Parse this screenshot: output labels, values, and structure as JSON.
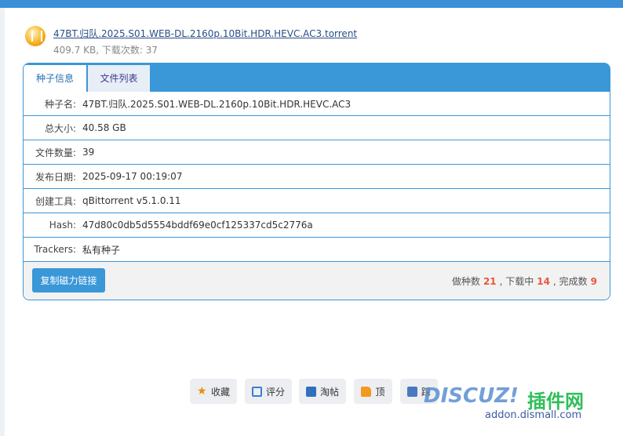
{
  "torrent": {
    "filename": "47BT.归队.2025.S01.WEB-DL.2160p.10Bit.HDR.HEVC.AC3.torrent",
    "meta": "409.7 KB, 下载次数: 37"
  },
  "tabs": [
    {
      "label": "种子信息",
      "active": true
    },
    {
      "label": "文件列表",
      "active": false
    }
  ],
  "rows": [
    {
      "label": "种子名:",
      "value": "47BT.归队.2025.S01.WEB-DL.2160p.10Bit.HDR.HEVC.AC3"
    },
    {
      "label": "总大小:",
      "value": "40.58 GB"
    },
    {
      "label": "文件数量:",
      "value": "39"
    },
    {
      "label": "发布日期:",
      "value": "2025-09-17 00:19:07"
    },
    {
      "label": "创建工具:",
      "value": "qBittorrent v5.1.0.11"
    },
    {
      "label": "Hash:",
      "value": "47d80c0db5d5554bddf69e0cf125337cd5c2776a"
    },
    {
      "label": "Trackers:",
      "value": "私有种子"
    }
  ],
  "footer": {
    "copy_magnet": "复制磁力链接",
    "seeders_label": "做种数",
    "seeders": "21",
    "leechers_label": ", 下载中",
    "leechers": "14",
    "completed_label": ", 完成数",
    "completed": "9"
  },
  "actions": [
    {
      "label": "收藏",
      "icon": "star-icon"
    },
    {
      "label": "评分",
      "icon": "calendar-icon"
    },
    {
      "label": "淘帖",
      "icon": "box-icon"
    },
    {
      "label": "顶",
      "icon": "thumbs-up-icon"
    },
    {
      "label": "踩",
      "icon": "thumbs-down-icon"
    }
  ],
  "watermark": {
    "brand": "DISCUZ!",
    "cn": "插件网",
    "url": "addon.dismall.com"
  },
  "colors": {
    "accent": "#3a97d8",
    "stat": "#e9573f"
  }
}
